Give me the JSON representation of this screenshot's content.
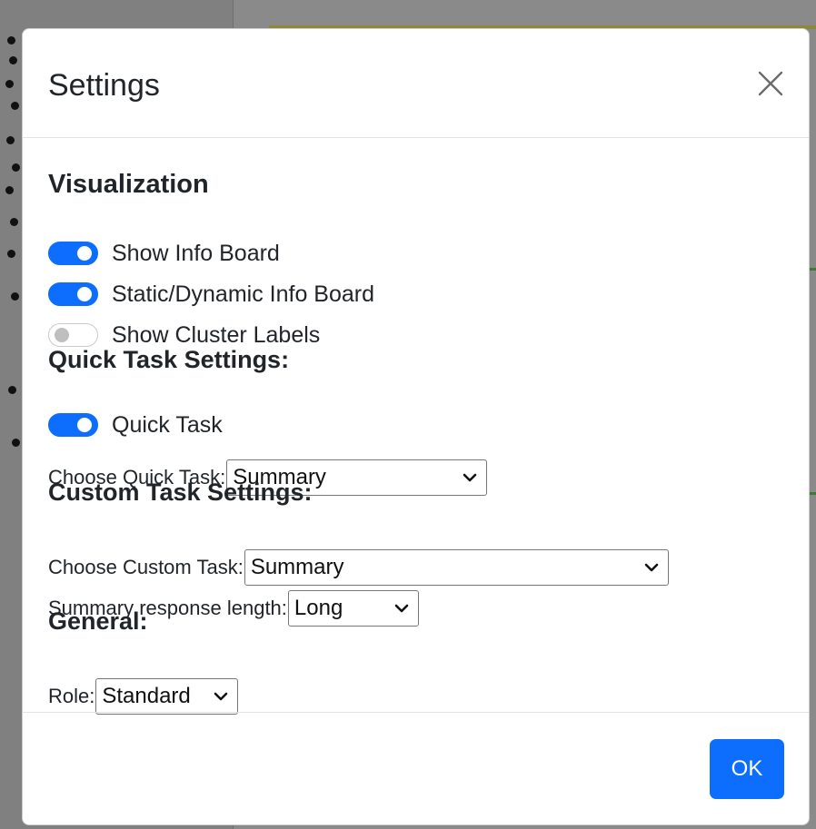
{
  "modal": {
    "title": "Settings",
    "close_icon": "close-icon"
  },
  "visualization": {
    "heading": "Visualization",
    "toggles": [
      {
        "label": "Show Info Board",
        "checked": true
      },
      {
        "label": "Static/Dynamic Info Board",
        "checked": true
      },
      {
        "label": "Show Cluster Labels",
        "checked": false
      }
    ]
  },
  "quick_task": {
    "heading": "Quick Task Settings:",
    "toggle": {
      "label": "Quick Task",
      "checked": true
    },
    "choose_label": "Choose Quick Task:",
    "choose_value": "Summary"
  },
  "custom_task": {
    "heading": "Custom Task Settings:",
    "choose_label": "Choose Custom Task:",
    "choose_value": "Summary",
    "length_label": "Summary response length:",
    "length_value": "Long"
  },
  "general": {
    "heading": "General:",
    "role_label": "Role:",
    "role_value": "Standard"
  },
  "footer": {
    "ok_label": "OK"
  },
  "colors": {
    "accent": "#0d6efd",
    "backdrop": "#808080"
  }
}
